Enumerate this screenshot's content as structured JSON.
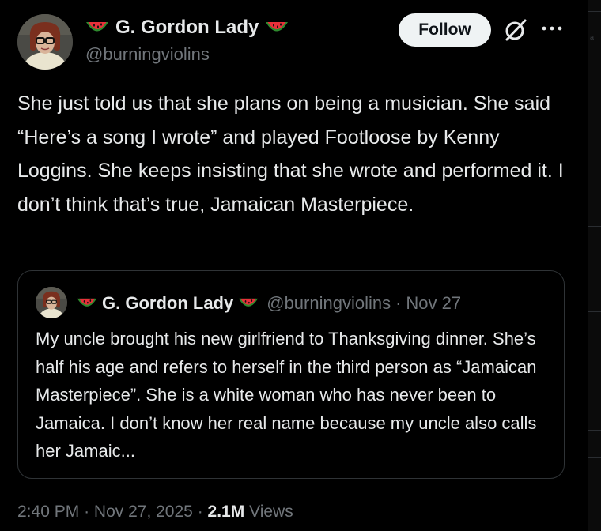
{
  "author": {
    "display_name": "G. Gordon Lady",
    "handle": "@burningviolins"
  },
  "actions": {
    "follow_label": "Follow"
  },
  "tweet": {
    "text": "She just told us that she plans on being a musician. She said “Here’s a song I wrote” and played Footloose by Kenny Loggins. She keeps insisting that she wrote and performed it. I don’t think that’s true, Jamaican Masterpiece."
  },
  "quote": {
    "display_name": "G. Gordon Lady",
    "handle": "@burningviolins",
    "separator": "·",
    "date": "Nov 27",
    "text": "My uncle brought his new girlfriend to Thanksgiving dinner. She’s half his age and refers to herself in the third person as “Jamaican Masterpiece”. She is a white woman who has never been to Jamaica. I don’t know her real name because my uncle also calls her Jamaic..."
  },
  "meta": {
    "time": "2:40 PM",
    "separator": "·",
    "date": "Nov 27, 2025",
    "views_count": "2.1M",
    "views_label": "Views"
  },
  "edge_strip": {
    "mark": "a"
  },
  "icons": {
    "name_emoji": "watermelon-icon",
    "grok": "grok-icon",
    "more": "more-icon"
  },
  "colors": {
    "background": "#000000",
    "text_primary": "#e7e9ea",
    "text_secondary": "#71767b",
    "follow_bg": "#eff3f4",
    "border": "#2f3336"
  }
}
